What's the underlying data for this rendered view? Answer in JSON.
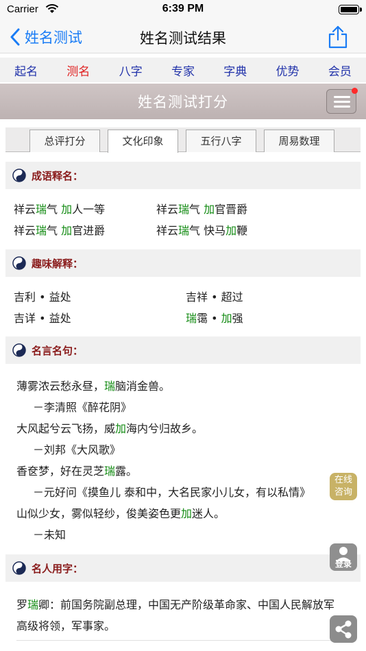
{
  "status": {
    "carrier": "Carrier",
    "time": "6:39 PM"
  },
  "nav": {
    "back_label": "姓名测试",
    "title": "姓名测试结果"
  },
  "top_tabs": [
    "起名",
    "测名",
    "八字",
    "专家",
    "字典",
    "优势",
    "会员"
  ],
  "banner": {
    "title": "姓名测试打分"
  },
  "sub_tabs": [
    "总评打分",
    "文化印象",
    "五行八字",
    "周易数理"
  ],
  "sections": {
    "idiom": {
      "title": "成语释名："
    },
    "fun": {
      "title": "趣味解释："
    },
    "quotes": {
      "title": "名言名句："
    },
    "famous": {
      "title": "名人用字："
    }
  },
  "idioms": {
    "r1c1": {
      "a": "祥云",
      "g1": "瑞",
      "b": "气 ",
      "g2": "加",
      "c": "人一等"
    },
    "r1c2": {
      "a": "祥云",
      "g1": "瑞",
      "b": "气 ",
      "g2": "加",
      "c": "官晋爵"
    },
    "r2c1": {
      "a": "祥云",
      "g1": "瑞",
      "b": "气 ",
      "g2": "加",
      "c": "官进爵"
    },
    "r2c2": {
      "a": "祥云",
      "g1": "瑞",
      "b": "气 快马",
      "g2": "加",
      "c": "鞭"
    }
  },
  "fun": {
    "r1c1": "吉利 • 益处",
    "r1c2": "吉祥 • 超过",
    "r2c1": "吉详 • 益处",
    "r2c2": {
      "g1": "瑞",
      "a": "霭 • ",
      "g2": "加",
      "b": "强"
    }
  },
  "quotes": {
    "q1": {
      "a": "薄雾浓云愁永昼，",
      "g": "瑞",
      "b": "脑消金兽。"
    },
    "a1": "－李清照《醉花阴》",
    "q2": {
      "a": "大风起兮云飞扬，威",
      "g": "加",
      "b": "海内兮归故乡。"
    },
    "a2": "－刘邦《大风歌》",
    "q3": {
      "a": "香奁梦，好在灵芝",
      "g": "瑞",
      "b": "露。"
    },
    "a3": "－元好问《摸鱼儿 泰和中，大名民家小儿女，有以私情》",
    "q4": {
      "a": "山似少女，雾似轻纱，俊美姿色更",
      "g": "加",
      "b": "迷人。"
    },
    "a4": "－未知"
  },
  "famous": {
    "line1": {
      "a": "罗",
      "g": "瑞",
      "b": "卿：前国务院副总理，中国无产阶级革命家、中国人民解放军"
    },
    "line2": "高级将领，军事家。"
  },
  "floats": {
    "online_line1": "在线",
    "online_line2": "咨询",
    "login": "登录"
  },
  "colors": {
    "accent": "#1a7cf5",
    "tab_active": "#e02020",
    "tab": "#2233aa",
    "section_title": "#8a1c1c",
    "highlight": "#118a11"
  }
}
